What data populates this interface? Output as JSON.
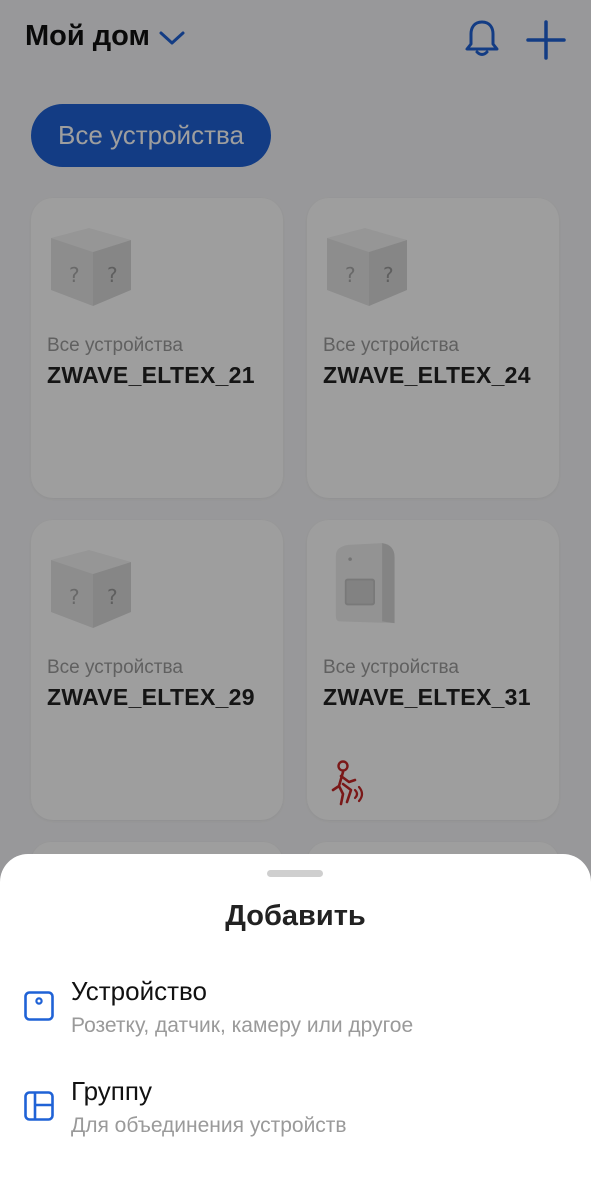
{
  "header": {
    "title": "Мой дом",
    "dropdown_icon": "chevron-down-icon",
    "notifications_icon": "bell-icon",
    "add_icon": "plus-icon"
  },
  "filter": {
    "chip_label": "Все устройства"
  },
  "devices": [
    {
      "room": "Все устройства",
      "name": "ZWAVE_ELTEX_21",
      "icon": "unknown-device-icon"
    },
    {
      "room": "Все устройства",
      "name": "ZWAVE_ELTEX_24",
      "icon": "unknown-device-icon"
    },
    {
      "room": "Все устройства",
      "name": "ZWAVE_ELTEX_29",
      "icon": "unknown-device-icon"
    },
    {
      "room": "Все устройства",
      "name": "ZWAVE_ELTEX_31",
      "icon": "motion-sensor-icon",
      "status_icon": "motion-detected-icon"
    }
  ],
  "sheet": {
    "title": "Добавить",
    "options": [
      {
        "label": "Устройство",
        "subtitle": "Розетку, датчик, камеру или другое",
        "icon": "device-icon"
      },
      {
        "label": "Группу",
        "subtitle": "Для объединения устройств",
        "icon": "group-icon"
      }
    ]
  },
  "colors": {
    "accent": "#1f62d6",
    "alert": "#c62828"
  }
}
